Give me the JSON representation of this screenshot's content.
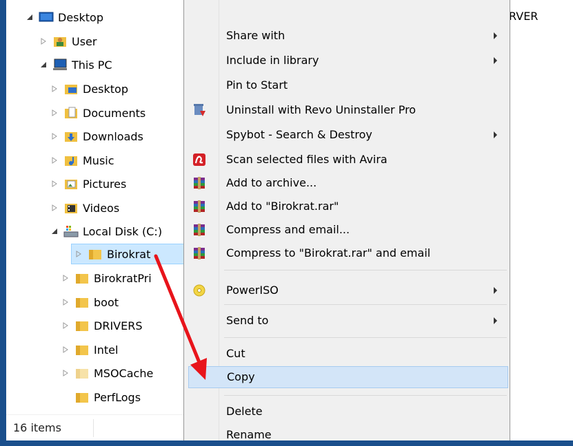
{
  "tree": {
    "items": [
      {
        "label": "Desktop",
        "icon": "desktop-icon",
        "expander": "expanded"
      },
      {
        "label": "User",
        "icon": "user-folder-icon",
        "expander": "collapsed"
      },
      {
        "label": "This PC",
        "icon": "computer-icon",
        "expander": "expanded"
      },
      {
        "label": "Desktop",
        "icon": "desktop-folder-icon",
        "expander": "collapsed"
      },
      {
        "label": "Documents",
        "icon": "documents-folder-icon",
        "expander": "collapsed"
      },
      {
        "label": "Downloads",
        "icon": "downloads-folder-icon",
        "expander": "collapsed"
      },
      {
        "label": "Music",
        "icon": "music-folder-icon",
        "expander": "collapsed"
      },
      {
        "label": "Pictures",
        "icon": "pictures-folder-icon",
        "expander": "collapsed"
      },
      {
        "label": "Videos",
        "icon": "videos-folder-icon",
        "expander": "collapsed"
      },
      {
        "label": "Local Disk (C:)",
        "icon": "drive-icon",
        "expander": "expanded"
      },
      {
        "label": "Birokrat",
        "icon": "folder-icon",
        "expander": "collapsed",
        "selected": true
      },
      {
        "label": "BirokratPri",
        "icon": "folder-icon",
        "expander": "collapsed"
      },
      {
        "label": "boot",
        "icon": "folder-icon",
        "expander": "collapsed"
      },
      {
        "label": "DRIVERS",
        "icon": "folder-icon",
        "expander": "collapsed"
      },
      {
        "label": "Intel",
        "icon": "folder-icon",
        "expander": "collapsed"
      },
      {
        "label": "MSOCache",
        "icon": "folder-icon",
        "expander": "collapsed"
      },
      {
        "label": "PerfLogs",
        "icon": "folder-icon",
        "expander": "none"
      }
    ]
  },
  "status": {
    "items_count": "16 items"
  },
  "right_pane": {
    "partial_text": "RVER"
  },
  "menu": {
    "items": [
      {
        "label": "Share with",
        "submenu": true
      },
      {
        "label": "Include in library",
        "submenu": true
      },
      {
        "label": "Pin to Start",
        "submenu": false
      },
      {
        "label": "Uninstall with Revo Uninstaller Pro",
        "submenu": false,
        "icon": "revo-uninstaller-icon"
      },
      {
        "label": "Spybot - Search & Destroy",
        "submenu": true
      },
      {
        "label": "Scan selected files with Avira",
        "submenu": false,
        "icon": "avira-icon"
      },
      {
        "label": "Add to archive...",
        "submenu": false,
        "icon": "winrar-icon"
      },
      {
        "label": "Add to \"Birokrat.rar\"",
        "submenu": false,
        "icon": "winrar-icon"
      },
      {
        "label": "Compress and email...",
        "submenu": false,
        "icon": "winrar-icon"
      },
      {
        "label": "Compress to \"Birokrat.rar\" and email",
        "submenu": false,
        "icon": "winrar-icon"
      },
      {
        "label": "PowerISO",
        "submenu": true,
        "icon": "poweriso-icon"
      },
      {
        "label": "Send to",
        "submenu": true
      },
      {
        "label": "Cut",
        "submenu": false
      },
      {
        "label": "Copy",
        "submenu": false,
        "highlighted": true
      },
      {
        "label": "Delete",
        "submenu": false
      },
      {
        "label": "Rename",
        "submenu": false
      }
    ]
  },
  "colors": {
    "annotation_arrow": "#e8141b",
    "selection": "#cce8ff",
    "menu_highlight": "#d3e5f8",
    "frame": "#1a4f8c"
  }
}
